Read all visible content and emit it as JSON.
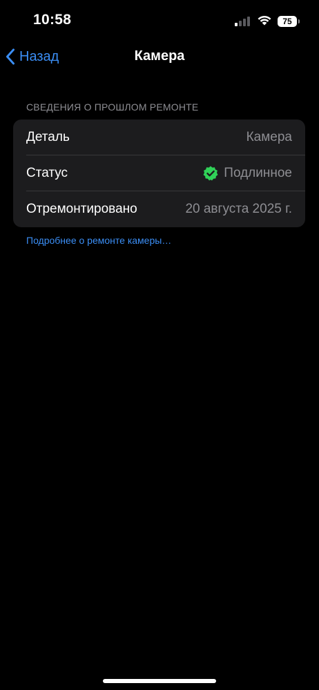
{
  "status_bar": {
    "time": "10:58",
    "battery_level": "75",
    "signal_bars_active": 1,
    "signal_bars_total": 4
  },
  "nav": {
    "back_label": "Назад",
    "title": "Камера"
  },
  "section": {
    "header": "СВЕДЕНИЯ О ПРОШЛОМ РЕМОНТЕ",
    "rows": [
      {
        "label": "Деталь",
        "value": "Камера"
      },
      {
        "label": "Статус",
        "value": "Подлинное",
        "icon": "verified-check-icon"
      },
      {
        "label": "Отремонтировано",
        "value": "20 августа 2025 г."
      }
    ],
    "footer_link": "Подробнее о ремонте камеры…"
  },
  "colors": {
    "background": "#000000",
    "group_background": "#1c1c1e",
    "accent_blue": "#3b8ef5",
    "secondary_text": "#8e8e93",
    "verified_green": "#30d158"
  }
}
